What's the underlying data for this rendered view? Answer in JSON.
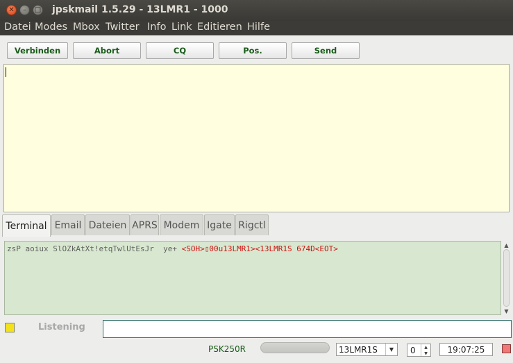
{
  "window": {
    "title": "jpskmail 1.5.29 - 13LMR1 - 1000",
    "close_glyph": "✕",
    "min_glyph": "–",
    "max_glyph": "□"
  },
  "menu": [
    "Datei",
    "Modes",
    "Mbox",
    "Twitter",
    "Info",
    "Link",
    "Editieren",
    "Hilfe"
  ],
  "toolbar": {
    "connect_label": "Verbinden",
    "abort_label": "Abort",
    "cq_label": "CQ",
    "pos_label": "Pos.",
    "send_label": "Send"
  },
  "tabs": [
    "Terminal",
    "Email",
    "Dateien",
    "APRS",
    "Modem",
    "Igate",
    "Rigctl"
  ],
  "active_tab": "Terminal",
  "terminal": {
    "gray_text": "zsP aoiux SlOZkAtXt!etqTwlUtEsJr  ye+ ",
    "red_text": "<SOH>▯00u13LMR1><13LMR1S 674D<EOT>"
  },
  "status": {
    "listening": "Listening",
    "mode": "PSK250R",
    "server": "13LMR1S",
    "channel": "0",
    "time": "19:07:25",
    "indicator_left_color": "#f3e21a",
    "indicator_right_color": "#f07878"
  },
  "colors": {
    "button_text": "#1a5c1a",
    "main_area_bg": "#ffffe0",
    "terminal_bg": "#d8e8d0",
    "terminal_red": "#cc1111"
  }
}
